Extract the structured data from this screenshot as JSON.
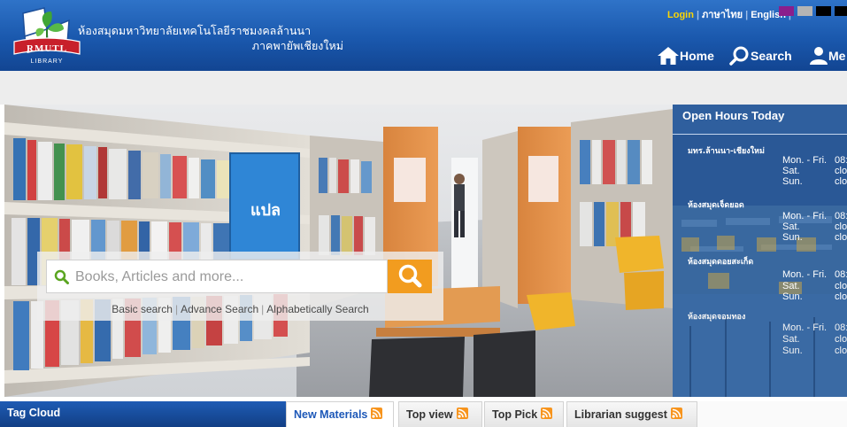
{
  "header": {
    "logo_text": "RMUTL",
    "logo_sub": "LIBRARY",
    "library_name_line1": "ห้องสมุดมหาวิทยาลัยเทคโนโลยีราชมงคลล้านนา",
    "library_name_line2": "ภาคพายัพเชียงใหม่",
    "top_links": {
      "login": "Login",
      "thai": "ภาษาไทย",
      "english": "English"
    },
    "theme_swatches": [
      "#8a1f8c",
      "#b4b4b4",
      "#000000",
      "#000000"
    ],
    "nav": {
      "home": "Home",
      "search": "Search",
      "member": "Me"
    }
  },
  "search": {
    "placeholder": "Books, Articles and more...",
    "links": {
      "basic": "Basic search",
      "advance": "Advance Search",
      "alpha": "Alphabetically Search"
    }
  },
  "hours": {
    "title": "Open Hours Today",
    "branches": [
      {
        "name": "มทร.ล้านนา-เชียงใหม่",
        "rows": [
          {
            "day": "Mon. - Fri.",
            "value": "08:"
          },
          {
            "day": "Sat.",
            "value": "clo"
          },
          {
            "day": "Sun.",
            "value": "clo"
          }
        ]
      },
      {
        "name": "ห้องสมุดเจ็ดยอด",
        "rows": [
          {
            "day": "Mon. - Fri.",
            "value": "08:"
          },
          {
            "day": "Sat.",
            "value": "clo"
          },
          {
            "day": "Sun.",
            "value": "clo"
          }
        ]
      },
      {
        "name": "ห้องสมุดดอยสะเก็ด",
        "rows": [
          {
            "day": "Mon. - Fri.",
            "value": "08:"
          },
          {
            "day": "Sat.",
            "value": "clo"
          },
          {
            "day": "Sun.",
            "value": "clo"
          }
        ]
      },
      {
        "name": "ห้องสมุดจอมทอง",
        "rows": [
          {
            "day": "Mon. - Fri.",
            "value": "08:"
          },
          {
            "day": "Sat.",
            "value": "clo"
          },
          {
            "day": "Sun.",
            "value": "clo"
          }
        ]
      }
    ]
  },
  "tabs": {
    "tag_cloud": "Tag Cloud",
    "new_materials": "New Materials",
    "top_view": "Top view",
    "top_pick": "Top Pick",
    "librarian_suggest": "Librarian suggest"
  },
  "hero_book_label": "แปล"
}
